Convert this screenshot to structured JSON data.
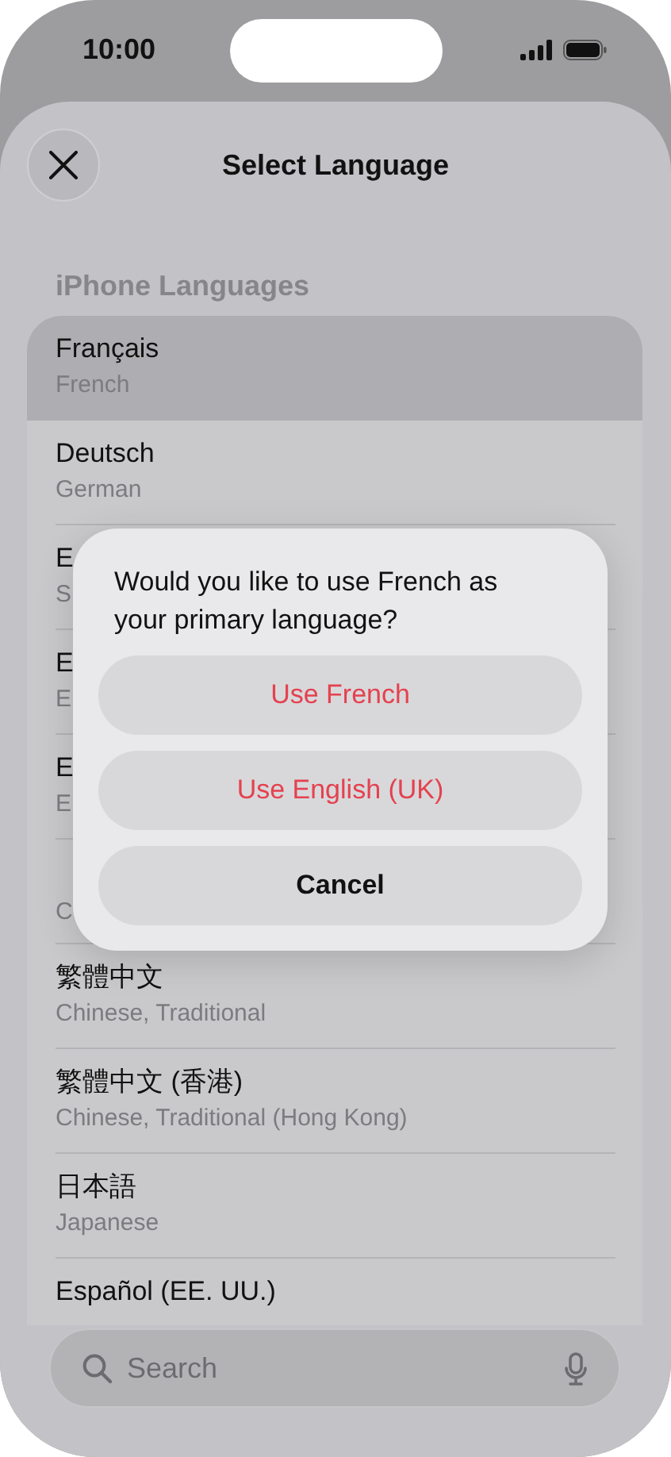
{
  "status_bar": {
    "time": "10:00"
  },
  "header": {
    "title": "Select Language"
  },
  "section": {
    "title": "iPhone Languages"
  },
  "rows": [
    {
      "name": "Français",
      "subtitle": "French",
      "selected": true
    },
    {
      "name": "Deutsch",
      "subtitle": "German",
      "selected": false
    },
    {
      "name": "E",
      "subtitle": "S",
      "selected": false
    },
    {
      "name": "E",
      "subtitle": "E",
      "selected": false
    },
    {
      "name": "E",
      "subtitle": "E",
      "selected": false
    },
    {
      "subtitle": "C",
      "selected": false
    },
    {
      "name": "繁體中文",
      "subtitle": "Chinese, Traditional",
      "selected": false
    },
    {
      "name": "繁體中文 (香港)",
      "subtitle": "Chinese, Traditional (Hong Kong)",
      "selected": false
    },
    {
      "name": "日本語",
      "subtitle": "Japanese",
      "selected": false
    },
    {
      "name": "Español (EE. UU.)",
      "selected": false
    }
  ],
  "dialog": {
    "message": "Would you like to use French as your primary language?",
    "buttons": [
      {
        "label": "Use French",
        "kind": "destructive"
      },
      {
        "label": "Use English (UK)",
        "kind": "destructive"
      },
      {
        "label": "Cancel",
        "kind": "default"
      }
    ]
  },
  "search": {
    "placeholder": "Search"
  }
}
